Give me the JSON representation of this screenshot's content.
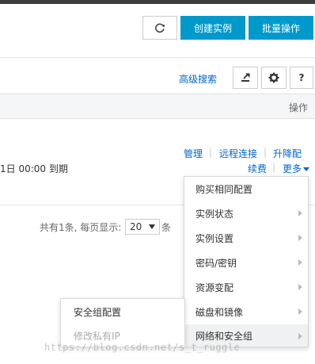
{
  "header": {
    "refresh_icon": "refresh-icon",
    "create_label": "创建实例",
    "batch_label": "批量操作"
  },
  "toolbar": {
    "advanced_search": "高级搜索",
    "export_icon": "export-icon",
    "settings_icon": "gear-icon",
    "help_label": "?"
  },
  "table": {
    "ops_header": "操作"
  },
  "row": {
    "actions": {
      "manage": "管理",
      "remote": "远程连接",
      "upgrade": "升降配",
      "renew": "续费",
      "more": "更多"
    },
    "expire": "1日 00:00 到期"
  },
  "pagination": {
    "summary": "共有1条, 每页显示:",
    "page_size": "20",
    "suffix": "条"
  },
  "menu": {
    "items": [
      {
        "label": "购买相同配置"
      },
      {
        "label": "实例状态"
      },
      {
        "label": "实例设置"
      },
      {
        "label": "密码/密钥"
      },
      {
        "label": "资源变配"
      },
      {
        "label": "磁盘和镜像"
      },
      {
        "label": "网络和安全组"
      }
    ]
  },
  "submenu": {
    "items": [
      {
        "label": "安全组配置"
      },
      {
        "label": "修改私有IP"
      }
    ]
  },
  "watermark": "https://blog.csdn.net/s_t_ruggle"
}
